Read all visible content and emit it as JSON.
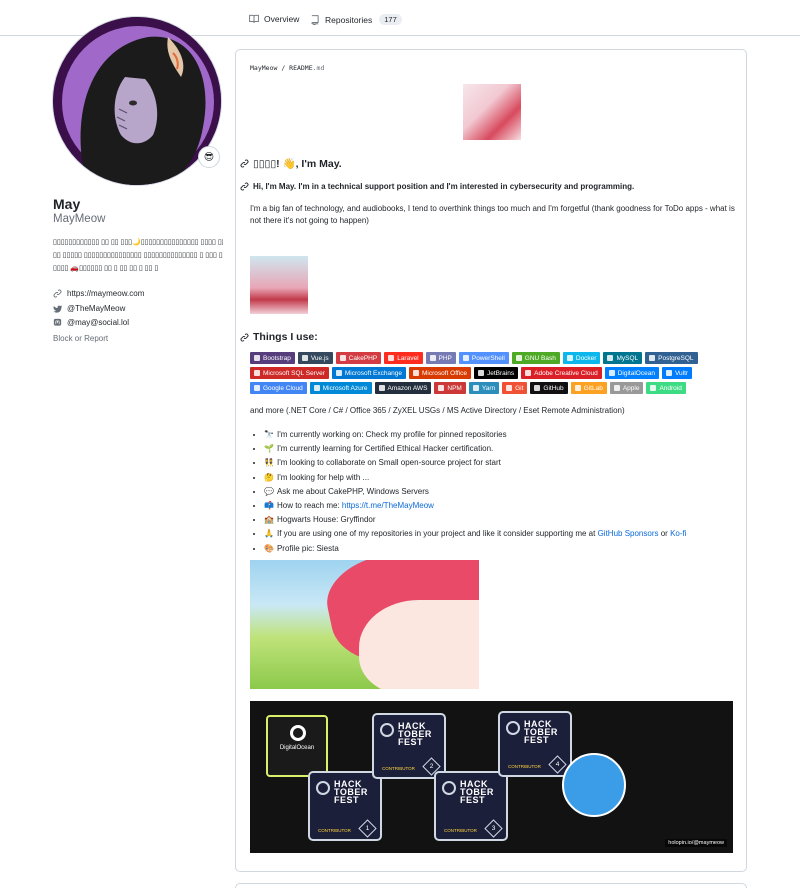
{
  "nav": {
    "overview_label": "Overview",
    "repositories_label": "Repositories",
    "repositories_count": "177"
  },
  "profile": {
    "status_emoji": "😎",
    "name": "May",
    "login": "MayMeow",
    "bio_lines": [
      "▯▯▯▯▯▯▯▯▯▯▯▯ ▯▯ ▯▯ ▯▯▯🌙▯▯▯▯▯▯▯▯▯▯▯▯▯▯▯ ▯▯▯▯ ▯▯▯▯",
      "▯▯ ▯▯▯▯▯ ▯▯▯▯▯▯▯▯▯▯▯▯▯▯▯ ▯▯▯▯▯▯▯▯▯▯▯▯▯▯ ▯ ▯▯▯ ▯",
      "▯▯▯▯ 🚗▯▯▯▯▯▯ ▯▯ ▯ ▯▯ ▯▯ ▯ ▯▯ ▯"
    ],
    "website": "https://maymeow.com",
    "twitter": "@TheMayMeow",
    "mastodon": "@may@social.lol",
    "block_label": "Block or Report"
  },
  "readme": {
    "breadcrumb_user": "MayMeow",
    "breadcrumb_sep": " / ",
    "breadcrumb_file": "README",
    "breadcrumb_ext": ".md",
    "heading1": "▯▯▯▯! 👋, I'm May.",
    "heading2": "Hi, I'm May. I'm in a technical support position and I'm interested in cybersecurity and programming.",
    "paragraph": "I'm a big fan of technology, and audiobooks, I tend to overthink things too much and I'm forgetful (thank goodness for ToDo apps - what is not there it's not going to happen)",
    "heading3": "Things I use:",
    "and_more": "and more (.NET Core / C# / Office 365 / ZyXEL USGs / MS Active Directory / Eset Remote Administration)",
    "list": [
      {
        "emoji": "🔭",
        "text": "I'm currently working on: Check my profile for pinned repositories"
      },
      {
        "emoji": "🌱",
        "text": "I'm currently learning for Certified Ethical Hacker certification."
      },
      {
        "emoji": "👯",
        "text": "I'm looking to collaborate on Small open-source project for start"
      },
      {
        "emoji": "🤔",
        "text": "I'm looking for help with ..."
      },
      {
        "emoji": "💬",
        "text": "Ask me about CakePHP, Windows Servers"
      },
      {
        "emoji": "📫",
        "text": "How to reach me: ",
        "link": "https://t.me/TheMayMeow"
      },
      {
        "emoji": "🏫",
        "text": "Hogwarts House: Gryffindor"
      },
      {
        "emoji": "🙏",
        "text": "If you are using one of my repositories in your project and like it consider supporting me at ",
        "link": "GitHub Sponsors",
        "mid": " or ",
        "link2": "Ko-fi"
      },
      {
        "emoji": "🎨",
        "text": "Profile pic: Siesta"
      }
    ],
    "holopin_url": "holopin.io/@maymeow",
    "holopin": {
      "do_label": "DigitalOcean",
      "badges": [
        {
          "title": "HACK TOBER FEST",
          "sub": "CONTRIBUTOR",
          "num": "1"
        },
        {
          "title": "HACK TOBER FEST",
          "sub": "CONTRIBUTOR",
          "num": "2"
        },
        {
          "title": "HACK TOBER FEST",
          "sub": "CONTRIBUTOR",
          "num": "3"
        },
        {
          "title": "HACK TOBER FEST",
          "sub": "CONTRIBUTOR",
          "num": "4"
        }
      ]
    }
  },
  "badges": [
    [
      {
        "label": "Bootstrap",
        "color": "#563d7c",
        "icon": "bootstrap-icon"
      },
      {
        "label": "Vue.js",
        "color": "#35495e",
        "icon": "vue-icon"
      },
      {
        "label": "CakePHP",
        "color": "#d33c43",
        "icon": "cakephp-icon"
      },
      {
        "label": "Laravel",
        "color": "#ff2d20",
        "icon": "laravel-icon"
      },
      {
        "label": "PHP",
        "color": "#777bb4",
        "icon": "php-icon"
      },
      {
        "label": "PowerShell",
        "color": "#5391fe",
        "icon": "powershell-icon"
      },
      {
        "label": "GNU Bash",
        "color": "#4eaa25",
        "icon": "bash-icon"
      },
      {
        "label": "Docker",
        "color": "#0db7ed",
        "icon": "docker-icon"
      },
      {
        "label": "MySQL",
        "color": "#00758f",
        "icon": "mysql-icon"
      },
      {
        "label": "PostgreSQL",
        "color": "#316192",
        "icon": "postgresql-icon"
      }
    ],
    [
      {
        "label": "Microsoft SQL Server",
        "color": "#cc2927",
        "icon": "mssql-icon"
      },
      {
        "label": "Microsoft Exchange",
        "color": "#0078d4",
        "icon": "exchange-icon"
      },
      {
        "label": "Microsoft Office",
        "color": "#d83b01",
        "icon": "office-icon"
      },
      {
        "label": "JetBrains",
        "color": "#000000",
        "icon": "jetbrains-icon"
      },
      {
        "label": "Adobe Creative Cloud",
        "color": "#da1f26",
        "icon": "adobe-icon"
      },
      {
        "label": "DigitalOcean",
        "color": "#0080ff",
        "icon": "digitalocean-icon"
      },
      {
        "label": "Vultr",
        "color": "#007bfc",
        "icon": "vultr-icon"
      }
    ],
    [
      {
        "label": "Google Cloud",
        "color": "#4285f4",
        "icon": "gcloud-icon"
      },
      {
        "label": "Microsoft Azure",
        "color": "#0089d6",
        "icon": "azure-icon"
      },
      {
        "label": "Amazon AWS",
        "color": "#232f3e",
        "icon": "aws-icon"
      },
      {
        "label": "NPM",
        "color": "#cb3837",
        "icon": "npm-icon"
      },
      {
        "label": "Yarn",
        "color": "#2c8ebb",
        "icon": "yarn-icon"
      },
      {
        "label": "Git",
        "color": "#f05033",
        "icon": "git-icon"
      },
      {
        "label": "GitHub",
        "color": "#121011",
        "icon": "github-icon"
      },
      {
        "label": "GitLab",
        "color": "#fca121",
        "icon": "gitlab-icon"
      },
      {
        "label": "Apple",
        "color": "#999999",
        "icon": "apple-icon"
      },
      {
        "label": "Android",
        "color": "#3ddc84",
        "icon": "android-icon"
      }
    ]
  ]
}
